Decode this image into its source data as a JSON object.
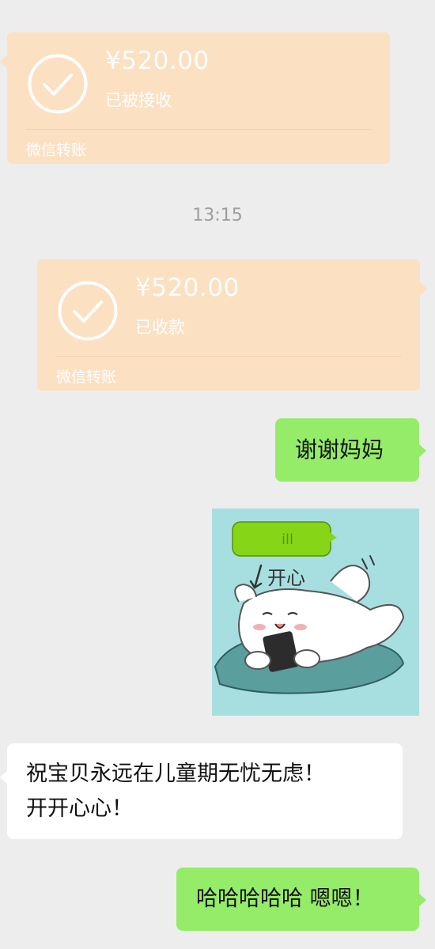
{
  "messages": {
    "transfer_received": {
      "amount": "¥520.00",
      "status": "已被接收",
      "footer": "微信转账"
    },
    "timestamp": "13:15",
    "transfer_accepted": {
      "amount": "¥520.00",
      "status": "已收款",
      "footer": "微信转账"
    },
    "thanks": "谢谢妈妈",
    "sticker": {
      "caption": "开心",
      "bubble_text": "ill"
    },
    "wish_line1": "祝宝贝永远在儿童期无忧无虑！",
    "wish_line2": "开开心心！",
    "reply": "哈哈哈哈哈 嗯嗯！"
  },
  "colors": {
    "background": "#ededed",
    "transfer_card": "#fbe0c2",
    "green_bubble": "#95ec69",
    "white_bubble": "#ffffff",
    "timestamp": "#9d9d9d",
    "sticker_background": "#a7dfe0"
  }
}
